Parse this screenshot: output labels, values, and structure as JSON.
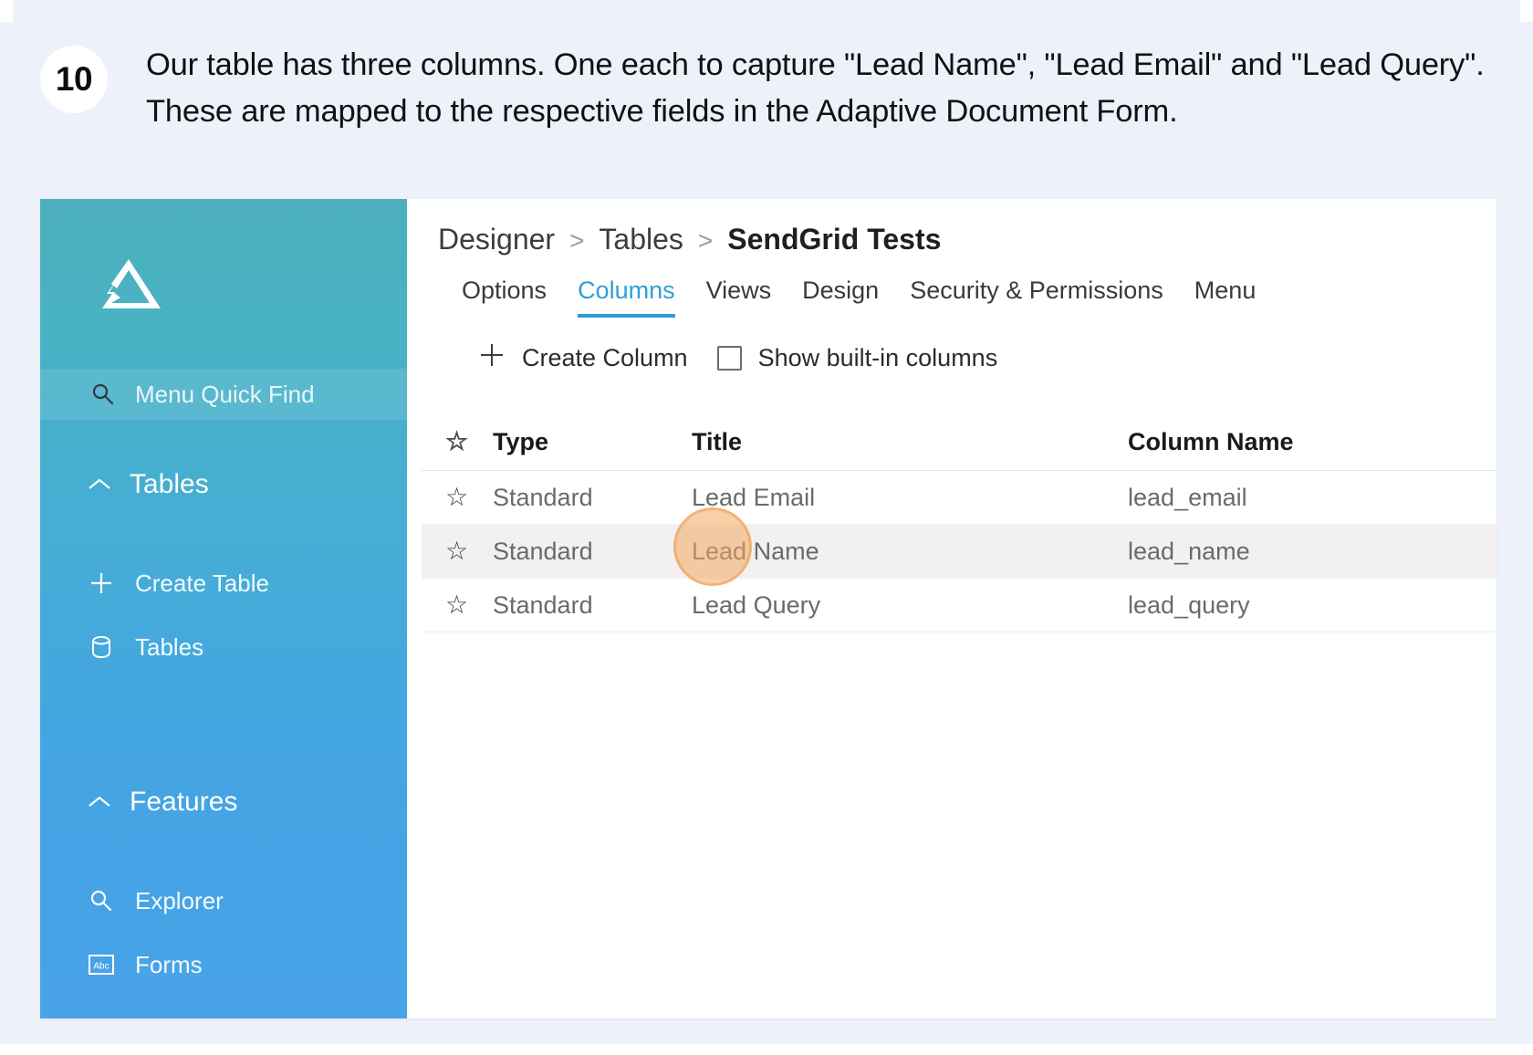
{
  "step": {
    "number": "10",
    "text": "Our table has three columns. One each to capture \"Lead Name\", \"Lead Email\" and \"Lead Query\". These are mapped to the respective fields in the Adaptive Document Form."
  },
  "sidebar": {
    "quick_find": {
      "label": "Menu Quick Find",
      "icon": "search-icon"
    },
    "groups": [
      {
        "label": "Tables",
        "icon": "chevron-up-icon",
        "items": [
          {
            "label": "Create Table",
            "icon": "plus-icon"
          },
          {
            "label": "Tables",
            "icon": "database-icon"
          }
        ]
      },
      {
        "label": "Features",
        "icon": "chevron-up-icon",
        "items": [
          {
            "label": "Explorer",
            "icon": "search-icon"
          },
          {
            "label": "Forms",
            "icon": "abc-icon"
          }
        ]
      }
    ]
  },
  "content": {
    "breadcrumb": [
      {
        "label": "Designer",
        "current": false
      },
      {
        "label": "Tables",
        "current": false
      },
      {
        "label": "SendGrid Tests",
        "current": true
      }
    ],
    "breadcrumb_separator": ">",
    "tabs": [
      {
        "label": "Options",
        "active": false
      },
      {
        "label": "Columns",
        "active": true
      },
      {
        "label": "Views",
        "active": false
      },
      {
        "label": "Design",
        "active": false
      },
      {
        "label": "Security & Permissions",
        "active": false
      },
      {
        "label": "Menu",
        "active": false
      }
    ],
    "toolbar": {
      "create_column_label": "Create Column",
      "create_column_icon": "plus-icon",
      "show_builtin_label": "Show built-in columns",
      "show_builtin_checked": false
    },
    "table": {
      "star_header_icon": "star-outline-icon",
      "headers": [
        "Type",
        "Title",
        "Column Name"
      ],
      "rows": [
        {
          "star": "☆",
          "type": "Standard",
          "title": "Lead Email",
          "column_name": "lead_email",
          "selected": false
        },
        {
          "star": "☆",
          "type": "Standard",
          "title": "Lead Name",
          "column_name": "lead_name",
          "selected": true
        },
        {
          "star": "☆",
          "type": "Standard",
          "title": "Lead Query",
          "column_name": "lead_query",
          "selected": false
        }
      ]
    }
  },
  "colors": {
    "page_background": "#edf1f9",
    "sidebar_top": "#4bb0bb",
    "sidebar_bottom": "#49a3e8",
    "accent_tab": "#2e9fd4",
    "selected_row": "#f2f1ef",
    "highlight_bubble": "#f3a85f"
  }
}
